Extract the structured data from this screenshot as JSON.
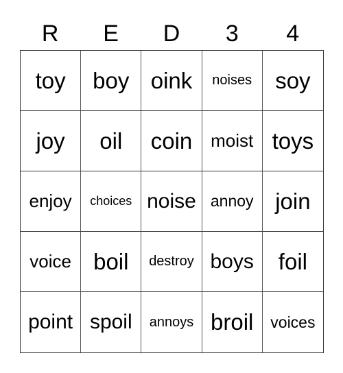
{
  "header": {
    "letters": [
      "R",
      "E",
      "D",
      "3",
      "4"
    ]
  },
  "board": {
    "rows": [
      [
        "toy",
        "boy",
        "oink",
        "noises",
        "soy"
      ],
      [
        "joy",
        "oil",
        "coin",
        "moist",
        "toys"
      ],
      [
        "enjoy",
        "choices",
        "noise",
        "annoy",
        "join"
      ],
      [
        "voice",
        "boil",
        "destroy",
        "boys",
        "foil"
      ],
      [
        "point",
        "spoil",
        "annoys",
        "broil",
        "voices"
      ]
    ]
  }
}
